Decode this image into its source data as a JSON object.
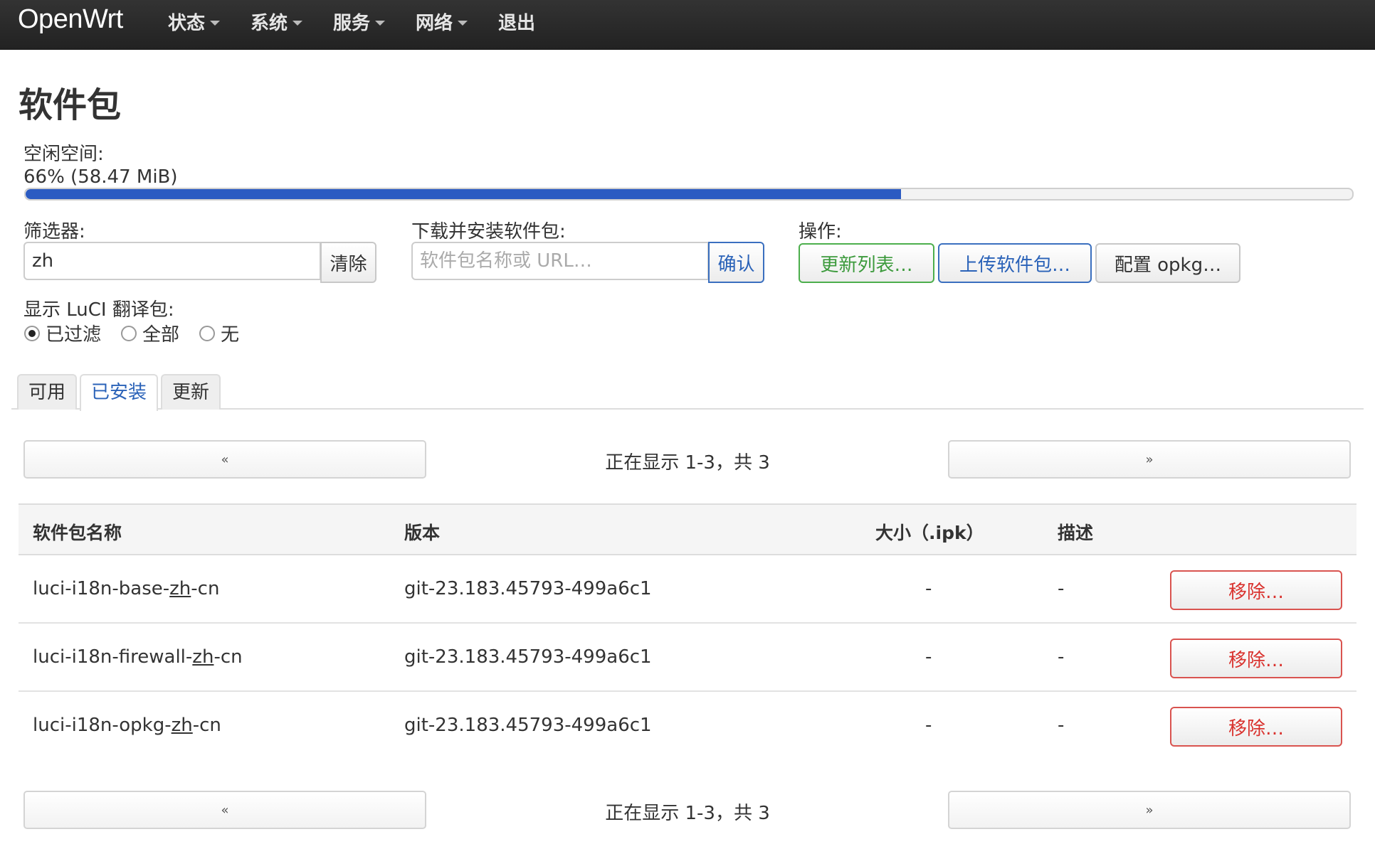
{
  "navbar": {
    "brand": "OpenWrt",
    "items": [
      {
        "label": "状态",
        "dropdown": true
      },
      {
        "label": "系统",
        "dropdown": true
      },
      {
        "label": "服务",
        "dropdown": true
      },
      {
        "label": "网络",
        "dropdown": true
      },
      {
        "label": "退出",
        "dropdown": false
      }
    ]
  },
  "page": {
    "title": "软件包",
    "free_space_label": "空闲空间:",
    "free_space_text": "66% (58.47 MiB)",
    "free_space_percent": 66
  },
  "filter": {
    "label": "筛选器:",
    "value": "zh",
    "clear_label": "清除"
  },
  "download": {
    "label": "下载并安装软件包:",
    "placeholder": "软件包名称或 URL…",
    "confirm_label": "确认"
  },
  "actions": {
    "label": "操作:",
    "update_lists": "更新列表…",
    "upload_package": "上传软件包…",
    "configure_opkg": "配置 opkg…"
  },
  "luci_translations": {
    "label": "显示 LuCI 翻译包:",
    "options": [
      {
        "label": "已过滤",
        "checked": true
      },
      {
        "label": "全部",
        "checked": false
      },
      {
        "label": "无",
        "checked": false
      }
    ]
  },
  "tabs": [
    {
      "label": "可用",
      "active": false
    },
    {
      "label": "已安装",
      "active": true
    },
    {
      "label": "更新",
      "active": false
    }
  ],
  "pager": {
    "prev": "«",
    "next": "»",
    "status": "正在显示 1-3，共 3"
  },
  "table": {
    "headers": [
      "软件包名称",
      "版本",
      "大小（.ipk）",
      "描述"
    ],
    "rows": [
      {
        "name_pre": "luci-i18n-base-",
        "name_match": "zh",
        "name_post": "-cn",
        "version": "git-23.183.45793-499a6c1",
        "size": "-",
        "description": "-",
        "action": "移除…"
      },
      {
        "name_pre": "luci-i18n-firewall-",
        "name_match": "zh",
        "name_post": "-cn",
        "version": "git-23.183.45793-499a6c1",
        "size": "-",
        "description": "-",
        "action": "移除…"
      },
      {
        "name_pre": "luci-i18n-opkg-",
        "name_match": "zh",
        "name_post": "-cn",
        "version": "git-23.183.45793-499a6c1",
        "size": "-",
        "description": "-",
        "action": "移除…"
      }
    ]
  },
  "colors": {
    "navbar": "#222222",
    "progress": "#2b5bc2",
    "link_blue": "#2a62b8",
    "success_green": "#3c9a3c",
    "danger_red": "#d9322e"
  }
}
